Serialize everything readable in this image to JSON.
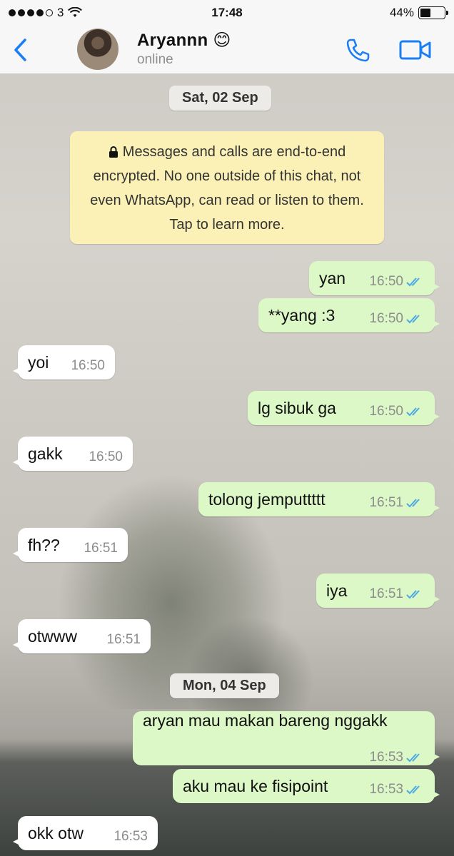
{
  "status_bar": {
    "carrier": "3",
    "time": "17:48",
    "battery": "44%",
    "battery_level": 0.44
  },
  "header": {
    "name": "Aryannn 😊",
    "status": "online"
  },
  "notice": {
    "text": "Messages and calls are end-to-end encrypted. No one outside of this chat, not even WhatsApp, can read or listen to them. Tap to learn more."
  },
  "dates": [
    "Sat, 02 Sep",
    "Mon, 04 Sep"
  ],
  "messages": [
    {
      "text": "yan",
      "time": "16:50",
      "dir": "out"
    },
    {
      "text": "**yang :3",
      "time": "16:50",
      "dir": "out"
    },
    {
      "text": "yoi",
      "time": "16:50",
      "dir": "in"
    },
    {
      "text": "lg sibuk ga",
      "time": "16:50",
      "dir": "out"
    },
    {
      "text": "gakk",
      "time": "16:50",
      "dir": "in"
    },
    {
      "text": "tolong jemputtttt",
      "time": "16:51",
      "dir": "out"
    },
    {
      "text": "fh??",
      "time": "16:51",
      "dir": "in"
    },
    {
      "text": "iya",
      "time": "16:51",
      "dir": "out"
    },
    {
      "text": "otwww",
      "time": "16:51",
      "dir": "in"
    },
    {
      "text": "aryan mau makan bareng nggakk",
      "time": "16:53",
      "dir": "out"
    },
    {
      "text": "aku mau ke fisipoint",
      "time": "16:53",
      "dir": "out"
    },
    {
      "text": "okk otw",
      "time": "16:53",
      "dir": "in"
    }
  ],
  "colors": {
    "outgoing": "#dcf8c6",
    "incoming": "#ffffff",
    "accent": "#1a7ef5",
    "read_ticks": "#4fa9e3",
    "notice": "#fbf1b6"
  },
  "icons": [
    "back-chevron-icon",
    "phone-icon",
    "video-camera-icon",
    "lock-icon",
    "double-check-icon"
  ]
}
